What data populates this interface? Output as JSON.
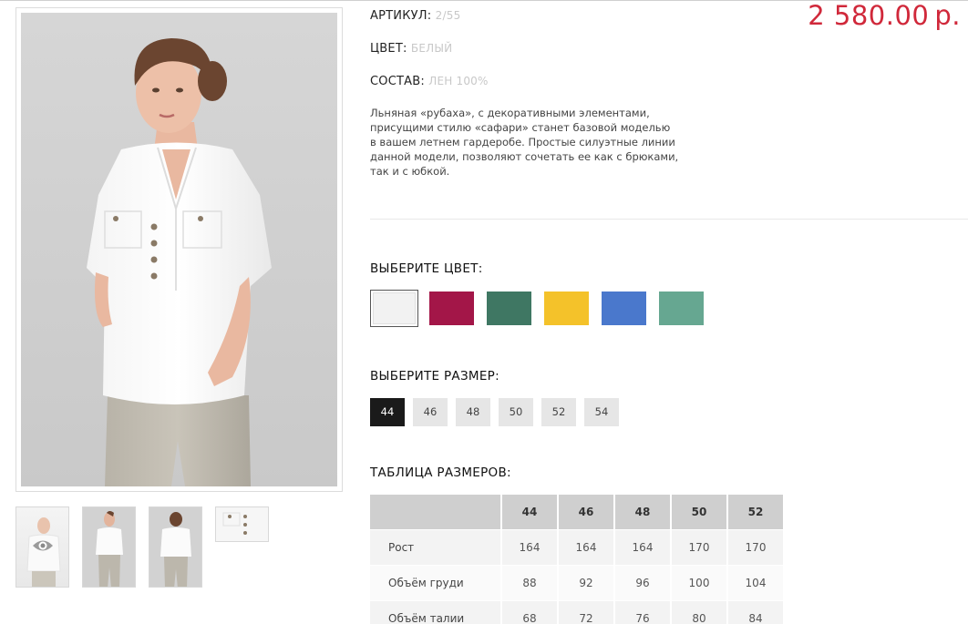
{
  "product": {
    "article_label": "АРТИКУЛ:",
    "article_value": "2/55",
    "color_label": "ЦВЕТ:",
    "color_value": "БЕЛЫЙ",
    "composition_label": "СОСТАВ:",
    "composition_value": "ЛЕН 100%",
    "price": "2 580.00",
    "currency": "р.",
    "description": [
      "Льняная «рубаха», с декоративными элементами,",
      "присущими стилю «сафари» станет базовой моделью",
      "в вашем летнем гардеробе. Простые силуэтные линии",
      "данной модели, позволяют сочетать ее как с брюками,",
      "так и с юбкой."
    ]
  },
  "color_picker": {
    "title": "ВЫБЕРИТЕ ЦВЕТ:",
    "swatches": [
      {
        "name": "white",
        "hex": "#f2f2f2",
        "selected": true
      },
      {
        "name": "raspberry",
        "hex": "#a31648",
        "selected": false
      },
      {
        "name": "dark-green",
        "hex": "#3f7763",
        "selected": false
      },
      {
        "name": "yellow",
        "hex": "#f4c22a",
        "selected": false
      },
      {
        "name": "blue",
        "hex": "#4a78cc",
        "selected": false
      },
      {
        "name": "sea-green",
        "hex": "#66a791",
        "selected": false
      }
    ]
  },
  "size_picker": {
    "title": "ВЫБЕРИТЕ РАЗМЕР:",
    "sizes": [
      "44",
      "46",
      "48",
      "50",
      "52",
      "54"
    ],
    "active": "44"
  },
  "size_table": {
    "title": "ТАБЛИЦА РАЗМЕРОВ:",
    "headers": [
      "44",
      "46",
      "48",
      "50",
      "52"
    ],
    "rows": [
      {
        "label": "Рост",
        "values": [
          "164",
          "164",
          "164",
          "170",
          "170"
        ]
      },
      {
        "label": "Объём груди",
        "values": [
          "88",
          "92",
          "96",
          "100",
          "104"
        ]
      },
      {
        "label": "Объём талии",
        "values": [
          "68",
          "72",
          "76",
          "80",
          "84"
        ]
      }
    ]
  },
  "icons": {
    "thumbnail_zoom": "eye-icon"
  }
}
